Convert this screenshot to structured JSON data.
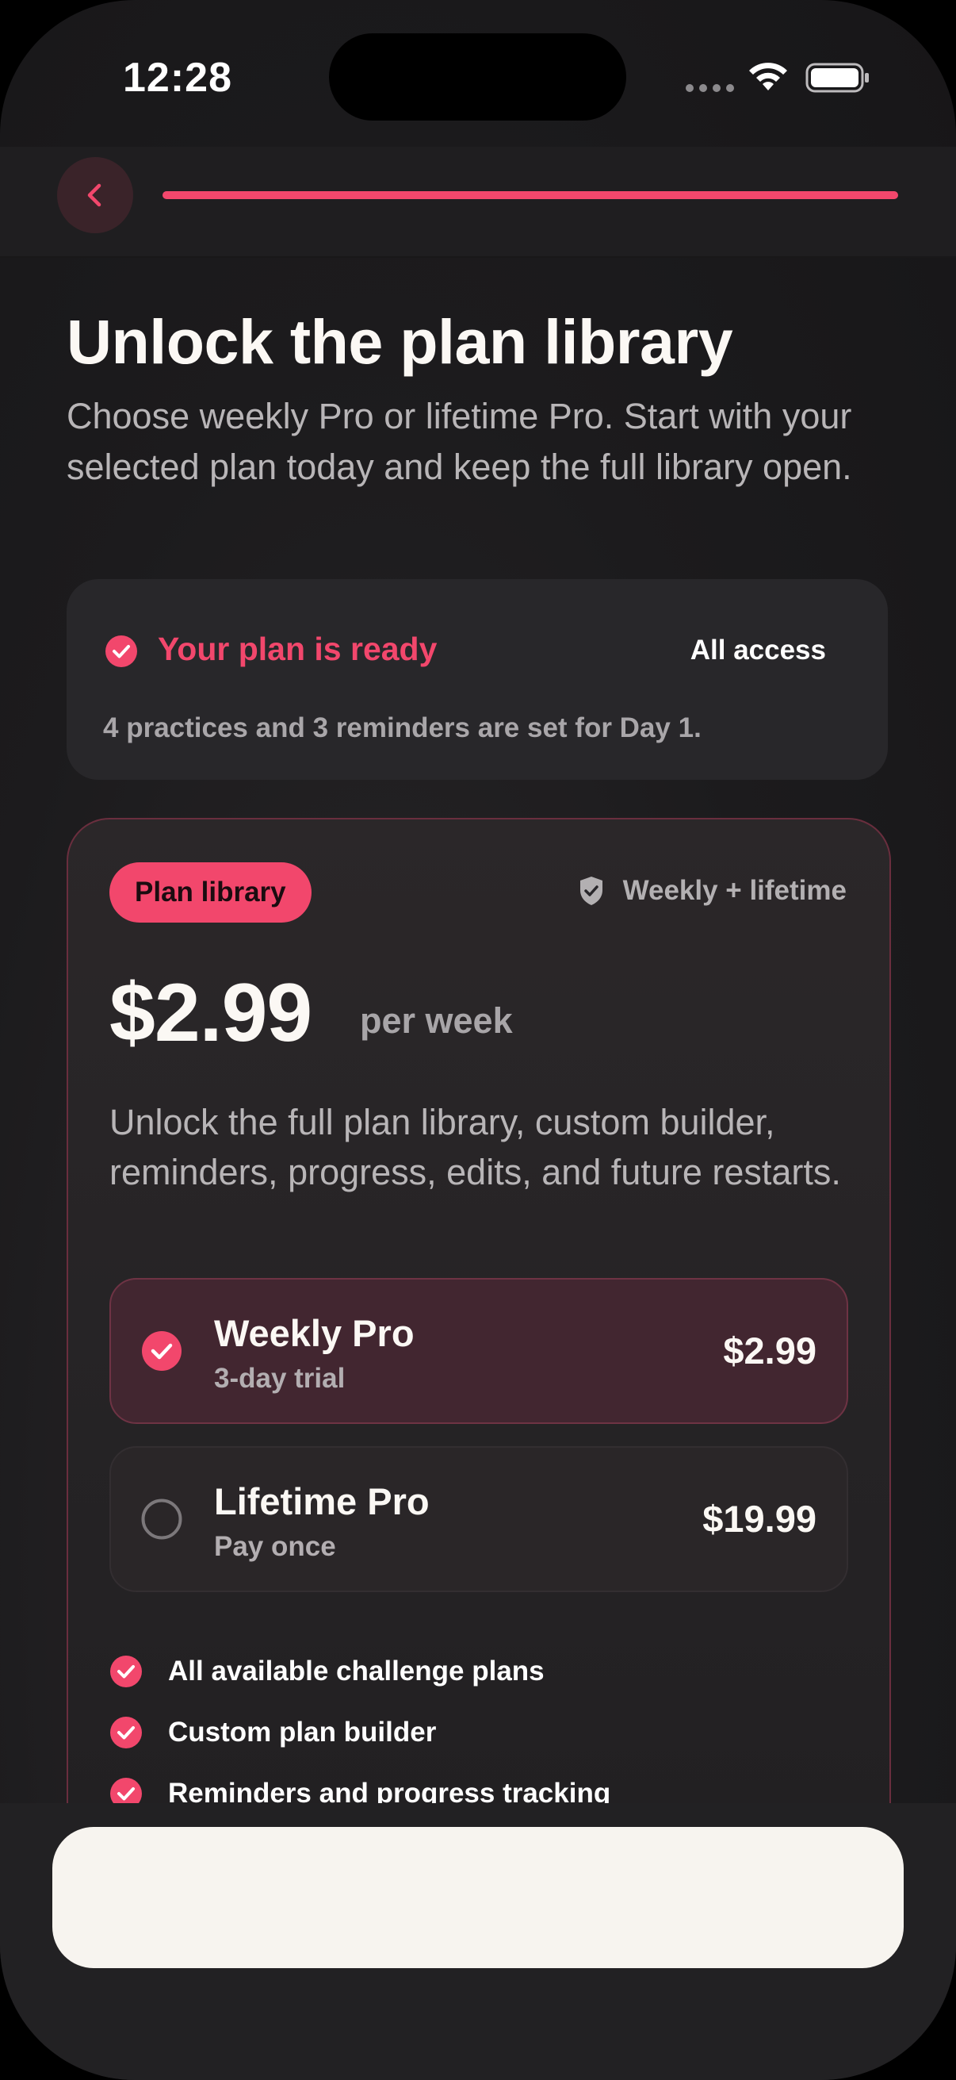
{
  "status_bar": {
    "time": "12:28"
  },
  "header": {
    "back_icon": "chevron-left-icon",
    "progress": 1.0
  },
  "title": "Unlock the plan library",
  "subtitle": "Choose weekly Pro or lifetime Pro. Start with your selected plan today and keep the full library open.",
  "ready_card": {
    "title": "Your plan is ready",
    "access_label": "All access",
    "description": "4 practices and 3 reminders are set for Day 1."
  },
  "plan_card": {
    "badge": "Plan library",
    "secure_label": "Weekly + lifetime",
    "price": "$2.99",
    "price_period": "per week",
    "description": "Unlock the full plan library, custom builder, reminders, progress, edits, and future restarts.",
    "options": [
      {
        "name": "Weekly Pro",
        "sub": "3-day trial",
        "price": "$2.99",
        "selected": true
      },
      {
        "name": "Lifetime Pro",
        "sub": "Pay once",
        "price": "$19.99",
        "selected": false
      }
    ],
    "features": [
      "All available challenge plans",
      "Custom plan builder",
      "Reminders and progress tracking"
    ]
  },
  "colors": {
    "accent": "#f2476c",
    "background": "#1c1b1d",
    "card": "#28272a",
    "cta": "#f7f4ef"
  }
}
